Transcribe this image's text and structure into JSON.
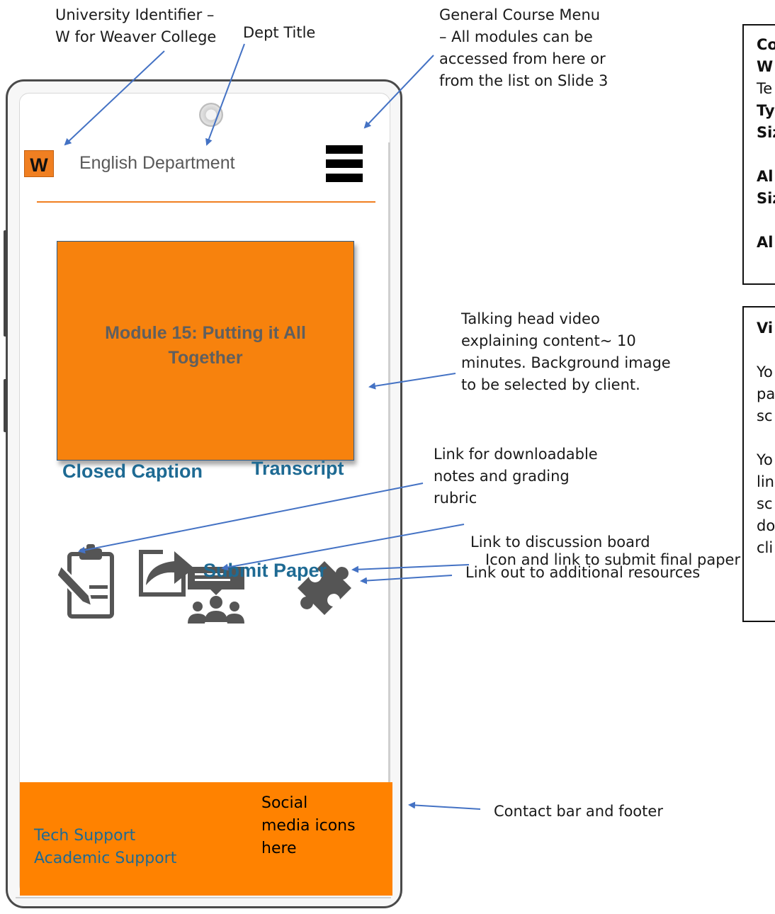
{
  "annotations": {
    "university_id": [
      "University  Identifier –",
      "W for Weaver College"
    ],
    "dept_title": "Dept Title",
    "course_menu": [
      "General Course Menu",
      "– All modules can be",
      "accessed from here or",
      "from the list on Slide 3"
    ],
    "video": [
      "Talking head video",
      "explaining content~ 10",
      "minutes. Background image",
      "to be selected by client."
    ],
    "notes_link": [
      "Link for downloadable",
      "notes and grading",
      "rubric"
    ],
    "discussion_link": "Link to discussion board",
    "resources_link": "Link out to additional resources",
    "submit_link": "Icon and link to submit final paper",
    "footer": "Contact bar and footer"
  },
  "right_boxes": {
    "box1": [
      "Co",
      "W",
      "Te",
      "Ty",
      "Siz",
      "",
      "Al",
      "Siz",
      "",
      "Al"
    ],
    "box2": [
      "Vi",
      "",
      "Yo",
      "pa",
      "sc",
      "",
      "Yo",
      "lin",
      "sc",
      "do",
      "cli"
    ]
  },
  "screen": {
    "logo_letter": "W",
    "dept_name": "English Department",
    "video_title": "Module 15: Putting it All Together",
    "closed_caption": "Closed Caption",
    "transcript": "Transcript",
    "submit_label": "Submit Paper",
    "footer": {
      "tech_support": "Tech Support",
      "academic_support": "Academic Support",
      "social": "Social media icons here"
    }
  },
  "icons": {
    "menu": "hamburger-menu-icon",
    "notes": "clipboard-pencil-icon",
    "discussion": "discussion-group-icon",
    "resources": "puzzle-piece-icon",
    "submit": "share-arrow-icon"
  },
  "colors": {
    "accent_orange": "#f7820d",
    "link_blue": "#1e6a93",
    "arrow_blue": "#4472c4",
    "icon_gray": "#555555"
  }
}
